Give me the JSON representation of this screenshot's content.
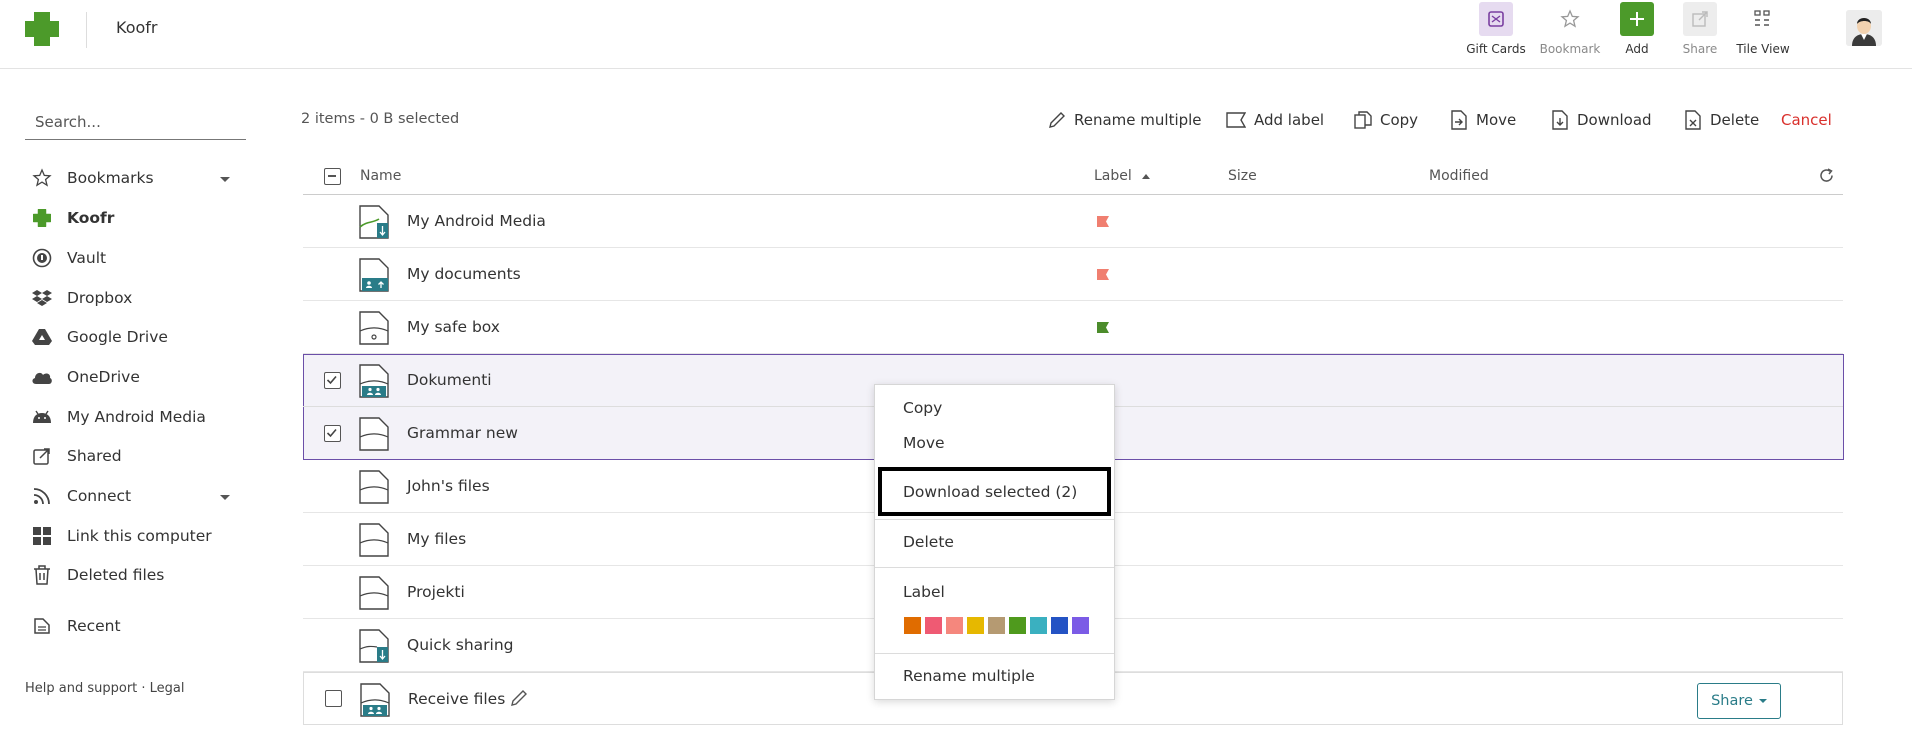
{
  "header": {
    "brand": "Koofr",
    "buttons": {
      "gift_cards": "Gift Cards",
      "bookmark": "Bookmark",
      "add": "Add",
      "share": "Share",
      "tile_view": "Tile View"
    }
  },
  "sidebar": {
    "search_placeholder": "Search...",
    "items": [
      {
        "label": "Bookmarks",
        "icon": "star-icon"
      },
      {
        "label": "Koofr",
        "icon": "koofr-icon"
      },
      {
        "label": "Vault",
        "icon": "vault-icon"
      },
      {
        "label": "Dropbox",
        "icon": "dropbox-icon"
      },
      {
        "label": "Google Drive",
        "icon": "google-drive-icon"
      },
      {
        "label": "OneDrive",
        "icon": "onedrive-icon"
      },
      {
        "label": "My Android Media",
        "icon": "android-icon"
      },
      {
        "label": "Shared",
        "icon": "shared-icon"
      },
      {
        "label": "Connect",
        "icon": "connect-icon"
      },
      {
        "label": "Link this computer",
        "icon": "windows-icon"
      },
      {
        "label": "Deleted files",
        "icon": "trash-icon"
      },
      {
        "label": "Recent",
        "icon": "recent-icon"
      }
    ],
    "footer": "Help and support · Legal"
  },
  "toolbar": {
    "selection_info": "2 items - 0 B selected",
    "rename_multiple": "Rename multiple",
    "add_label": "Add label",
    "copy": "Copy",
    "move": "Move",
    "download": "Download",
    "delete": "Delete",
    "cancel": "Cancel"
  },
  "table": {
    "columns": {
      "name": "Name",
      "label": "Label",
      "size": "Size",
      "modified": "Modified"
    },
    "rows": [
      {
        "name": "My Android Media",
        "flag": "#f07f70"
      },
      {
        "name": "My documents",
        "flag": "#f07f70"
      },
      {
        "name": "My safe box",
        "flag": "#4c8c2b"
      },
      {
        "name": "Dokumenti",
        "selected": true
      },
      {
        "name": "Grammar new",
        "selected": true
      },
      {
        "name": "John's files"
      },
      {
        "name": "My files"
      },
      {
        "name": "Projekti"
      },
      {
        "name": "Quick sharing"
      },
      {
        "name": "Receive files",
        "share_label": "Share"
      }
    ]
  },
  "context_menu": {
    "copy": "Copy",
    "move": "Move",
    "download_selected": "Download selected (2)",
    "delete": "Delete",
    "label": "Label",
    "rename_multiple": "Rename multiple",
    "label_colors": [
      "#e06c00",
      "#ef5a73",
      "#f5877d",
      "#e6b800",
      "#b59a72",
      "#4f9a1d",
      "#3ab0c0",
      "#2453c4",
      "#7b5be6"
    ]
  },
  "colors": {
    "brand_green": "#4c9a2a",
    "selection_border": "#6b4fa8",
    "cancel_red": "#d9302c",
    "teal": "#2a7c88"
  }
}
